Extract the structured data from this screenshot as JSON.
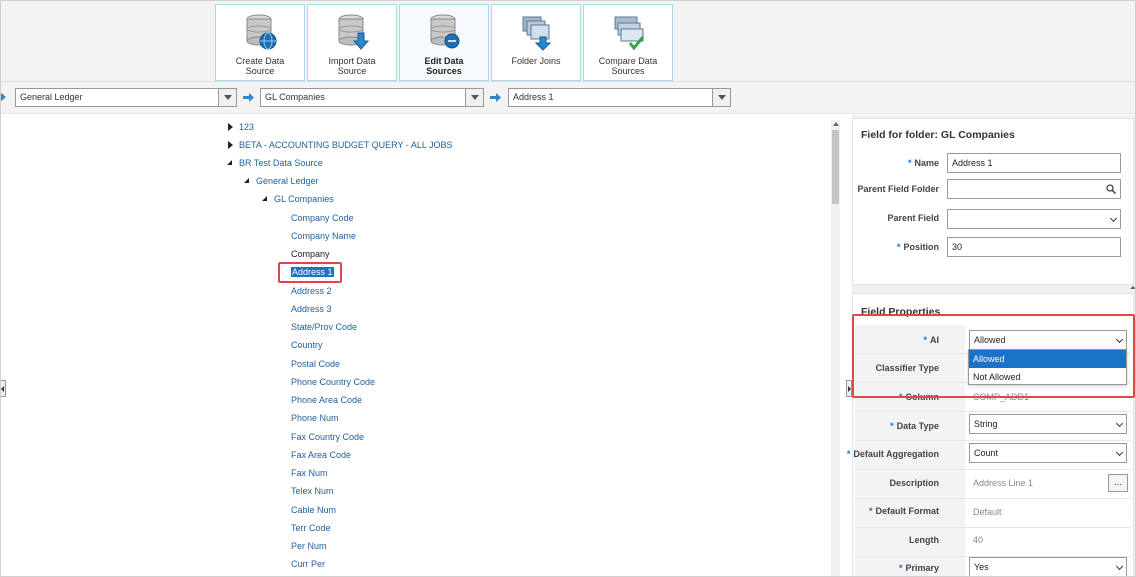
{
  "toolbar": {
    "buttons": [
      {
        "label": "Create Data Source",
        "icon": "database-globe-icon"
      },
      {
        "label": "Import Data Source",
        "icon": "database-import-icon"
      },
      {
        "label": "Edit Data Sources",
        "icon": "database-edit-icon",
        "active": true
      },
      {
        "label": "Folder Joins",
        "icon": "folder-joins-icon"
      },
      {
        "label": "Compare Data Sources",
        "icon": "compare-data-sources-icon"
      }
    ]
  },
  "selectors": {
    "data_source": "General Ledger",
    "folder": "GL Companies",
    "field": "Address 1"
  },
  "tree": {
    "nodes": [
      "123",
      "BETA - ACCOUNTING BUDGET QUERY - ALL JOBS",
      "BR Test Data Source",
      "General Ledger",
      "GL Companies",
      "Company Code",
      "Company Name",
      "Company",
      "Address 1",
      "Address 2",
      "Address 3",
      "State/Prov Code",
      "Country",
      "Postal Code",
      "Phone Country Code",
      "Phone Area Code",
      "Phone Num",
      "Fax Country Code",
      "Fax Area Code",
      "Fax Num",
      "Telex Num",
      "Cable Num",
      "Terr Code",
      "Per Num",
      "Curr Per"
    ],
    "selected": "Address 1"
  },
  "field_panel": {
    "title": "Field for folder: GL Companies",
    "name_label": "Name",
    "name_value": "Address 1",
    "parent_folder_label": "Parent Field Folder",
    "parent_folder_value": "",
    "parent_field_label": "Parent Field",
    "parent_field_value": "",
    "position_label": "Position",
    "position_value": "30"
  },
  "properties": {
    "title": "Field Properties",
    "ai_label": "AI",
    "ai_value": "Allowed",
    "ai_options": [
      "Allowed",
      "Not Allowed"
    ],
    "classifier_label": "Classifier Type",
    "column_label": "Column",
    "column_value": "COMP_ADD1",
    "data_type_label": "Data Type",
    "data_type_value": "String",
    "default_agg_label": "Default Aggregation",
    "default_agg_value": "Count",
    "description_label": "Description",
    "description_value": "Address Line 1",
    "description_button": "...",
    "default_format_label": "Default Format",
    "default_format_value": "Default",
    "length_label": "Length",
    "length_value": "40",
    "primary_label": "Primary",
    "primary_value": "Yes"
  },
  "colors": {
    "accent": "#1a73c9",
    "highlight_border": "#e04848",
    "tree_link": "#1f5f9e"
  }
}
